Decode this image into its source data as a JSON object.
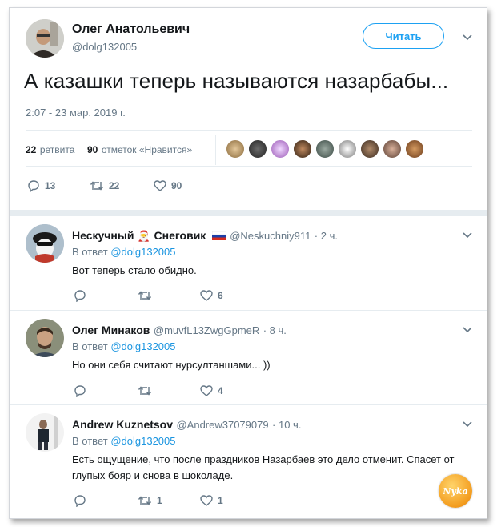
{
  "tweet": {
    "author_name": "Олег Анатольевич",
    "author_handle": "@dolg132005",
    "follow_label": "Читать",
    "text": "А казашки теперь называются назарбабы...",
    "timestamp": "2:07 - 23 мар. 2019 г.",
    "retweets_count": "22",
    "retweets_label": "ретвита",
    "likes_count": "90",
    "likes_label": "отметок «Нравится»",
    "actions": {
      "replies": "13",
      "retweets": "22",
      "likes": "90"
    }
  },
  "replies": [
    {
      "name_part1": "Нескучный",
      "name_emoji_1": "🎅",
      "name_part2": "Снеговик",
      "name_emoji_2": "🇷🇺",
      "handle": "@Neskuchniy911",
      "time": "· 2 ч.",
      "reply_prefix": "В ответ",
      "reply_handle": "@dolg132005",
      "text": "Вот теперь стало обидно.",
      "actions": {
        "replies": "",
        "retweets": "",
        "likes": "6"
      }
    },
    {
      "name": "Олег Минаков",
      "handle": "@muvfL13ZwgGpmeR",
      "time": "· 8 ч.",
      "reply_prefix": "В ответ",
      "reply_handle": "@dolg132005",
      "text": "Но они себя считают нурсултаншами... ))",
      "actions": {
        "replies": "",
        "retweets": "",
        "likes": "4"
      }
    },
    {
      "name": "Andrew Kuznetsov",
      "handle": "@Andrew37079079",
      "time": "· 10 ч.",
      "reply_prefix": "В ответ",
      "reply_handle": "@dolg132005",
      "text_line1": "Есть ощущение, что после праздников Назарбаев это дело отменит. Спасет от",
      "text_line2": "глупых бояр и снова в шоколаде.",
      "actions": {
        "replies": "",
        "retweets": "1",
        "likes": "1"
      }
    }
  ],
  "watermark": "Nyka",
  "colors": {
    "accent": "#1da1f2",
    "link": "#1b95e0",
    "muted": "#657786",
    "text": "#14171a",
    "watermark": "#f39c1e"
  },
  "icons": [
    "reply-icon",
    "retweet-icon",
    "like-icon",
    "chevron-down-icon"
  ]
}
